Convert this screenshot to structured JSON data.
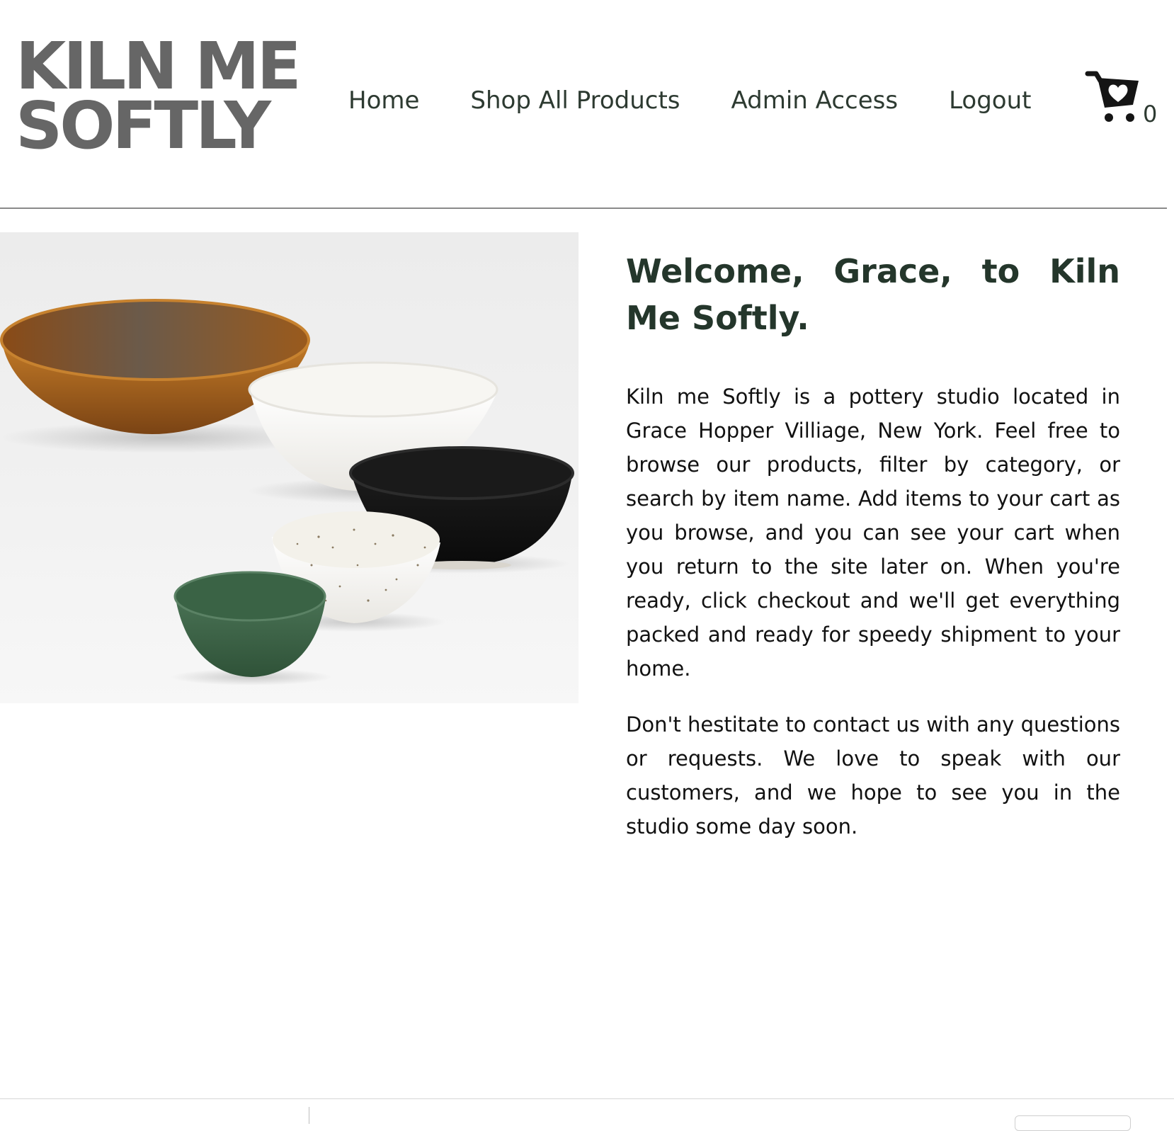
{
  "brand": {
    "line1": "KILN ME",
    "line2": "SOFTLY"
  },
  "nav": {
    "items": [
      {
        "label": "Home"
      },
      {
        "label": "Shop All Products"
      },
      {
        "label": "Admin Access"
      },
      {
        "label": "Logout"
      }
    ]
  },
  "cart": {
    "icon": "cart-heart-icon",
    "count": "0"
  },
  "hero": {
    "image": "ceramic-bowls-photo",
    "bowl_colors": [
      "#b06a1f",
      "#f6f4ef",
      "#151515",
      "#f1eee6",
      "#3d6548"
    ]
  },
  "welcome": {
    "title": "Welcome, Grace, to Kiln Me Softly.",
    "paragraph1": "Kiln me Softly is a pottery studio located in Grace Hopper Villiage, New York. Feel free to browse our products, filter by category, or search by item name. Add items to your cart as you browse, and you can see your cart when you return to the site later on. When you're ready, click checkout and we'll get everything packed and ready for speedy shipment to your home.",
    "paragraph2": "Don't hestitate to contact us with any questions or requests. We love to speak with our customers, and we hope to see you in the studio some day soon."
  },
  "colors": {
    "logo": "#666666",
    "nav_text": "#2d3a31",
    "heading": "#24362b",
    "body_text": "#111111",
    "rule": "#8a8a8a"
  }
}
